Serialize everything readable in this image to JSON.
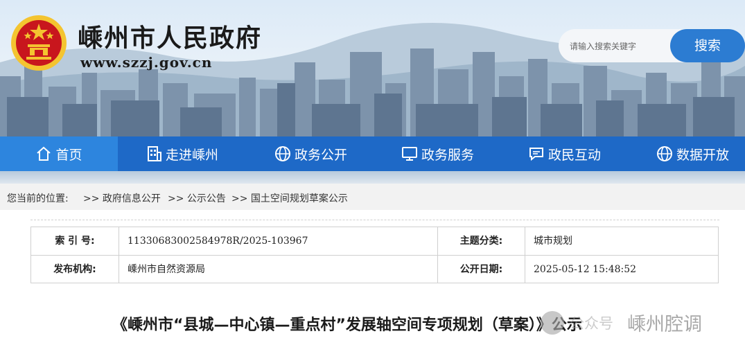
{
  "header": {
    "site_title": "嵊州市人民政府",
    "site_url": "www.szzj.gov.cn",
    "search": {
      "placeholder": "请输入搜索关键字",
      "button_label": "搜索"
    }
  },
  "colors": {
    "nav_bg": "#1e69c7",
    "nav_active": "#2d85de",
    "search_button": "#2c7cd2",
    "emblem_red": "#c8161d",
    "emblem_gold": "#f4c430"
  },
  "nav": {
    "items": [
      {
        "label": "首页",
        "icon": "home-icon"
      },
      {
        "label": "走进嵊州",
        "icon": "building-icon"
      },
      {
        "label": "政务公开",
        "icon": "globe-icon"
      },
      {
        "label": "政务服务",
        "icon": "monitor-icon"
      },
      {
        "label": "政民互动",
        "icon": "chat-icon"
      },
      {
        "label": "数据开放",
        "icon": "globe-icon"
      }
    ]
  },
  "breadcrumb": {
    "label": "您当前的位置:",
    "items": [
      ">> 政府信息公开",
      ">> 公示公告",
      ">> 国土空间规划草案公示"
    ]
  },
  "info": {
    "index_label": "索 引 号:",
    "index_value": "11330683002584978R/2025-103967",
    "topic_label": "主题分类:",
    "topic_value": "城市规划",
    "publisher_label": "发布机构:",
    "publisher_value": "嵊州市自然资源局",
    "date_label": "公开日期:",
    "date_value": "2025-05-12 15:48:52"
  },
  "article": {
    "title": "《嵊州市“县城—中心镇—重点村”发展轴空间专项规划（草案）》公示"
  },
  "watermark": {
    "small": "公众号",
    "text": "嵊州腔调"
  }
}
